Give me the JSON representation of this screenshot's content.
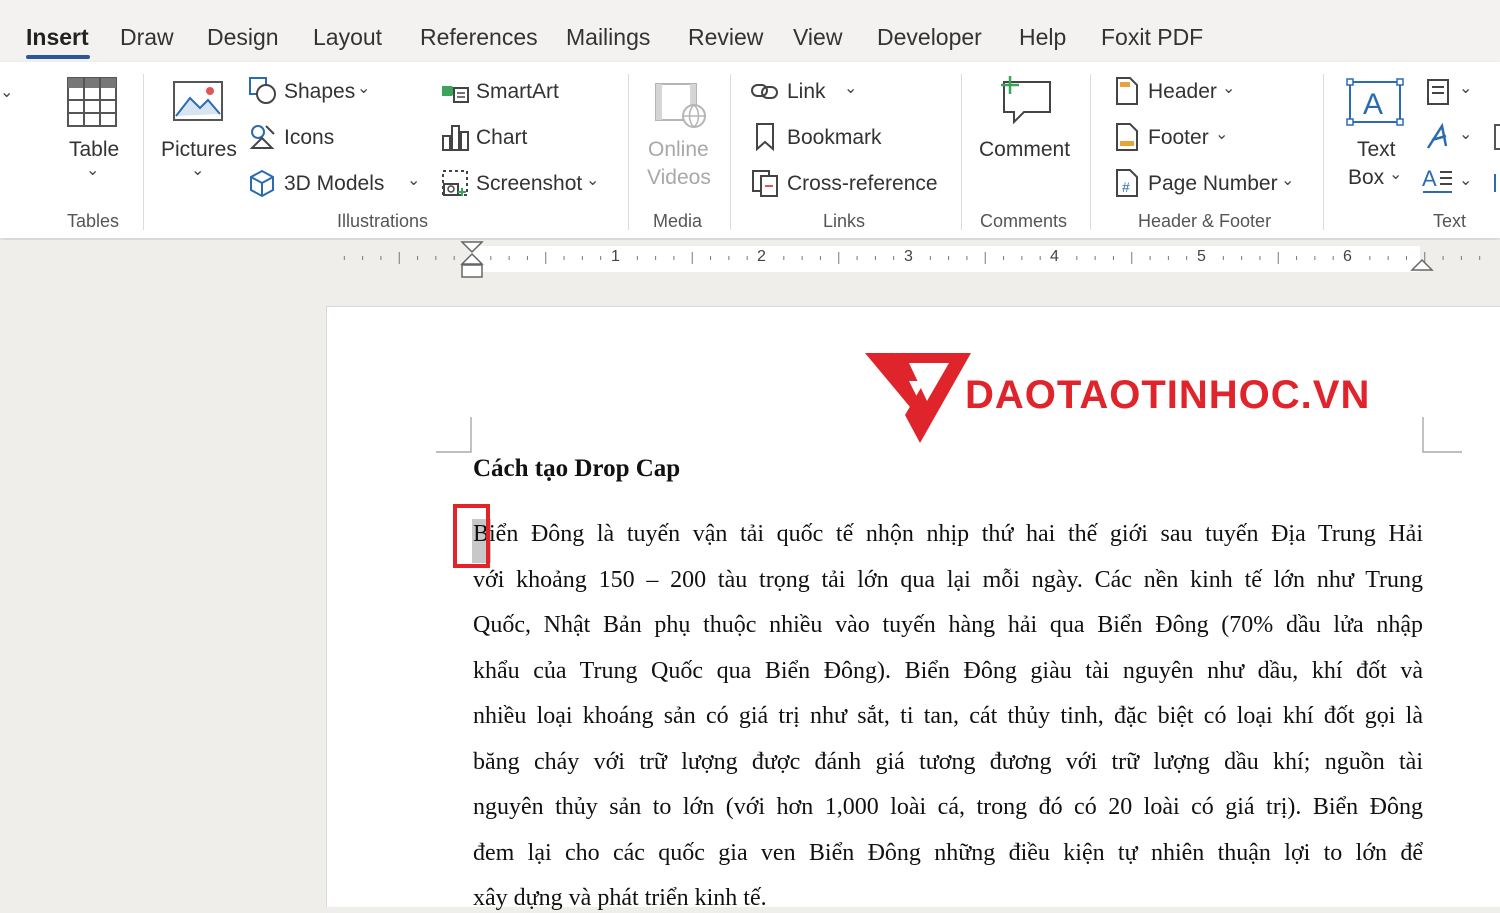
{
  "tabs": [
    "Insert",
    "Draw",
    "Design",
    "Layout",
    "References",
    "Mailings",
    "Review",
    "View",
    "Developer",
    "Help",
    "Foxit PDF"
  ],
  "active_tab": "Insert",
  "ribbon": {
    "tables": {
      "table_label": "Table",
      "group_label": "Tables",
      "icon": "table-icon"
    },
    "illustrations": {
      "pictures_label": "Pictures",
      "shapes_label": "Shapes",
      "icons_label": "Icons",
      "models_label": "3D Models",
      "smartart_label": "SmartArt",
      "chart_label": "Chart",
      "screenshot_label": "Screenshot",
      "group_label": "Illustrations"
    },
    "media": {
      "online_label": "Online",
      "videos_label": "Videos",
      "group_label": "Media"
    },
    "links": {
      "link_label": "Link",
      "bookmark_label": "Bookmark",
      "crossref_label": "Cross-reference",
      "group_label": "Links"
    },
    "comments": {
      "comment_label": "Comment",
      "group_label": "Comments"
    },
    "header_footer": {
      "header_label": "Header",
      "footer_label": "Footer",
      "page_number_label": "Page Number",
      "group_label": "Header & Footer"
    },
    "text": {
      "textbox_label_1": "Text",
      "textbox_label_2": "Box",
      "group_label": "Text"
    }
  },
  "ruler": {
    "numbers": [
      "1",
      "2",
      "3",
      "4",
      "5",
      "6"
    ]
  },
  "document": {
    "logo_text": "DAOTAOTINHOC.VN",
    "heading": "Cách tạo Drop Cap",
    "paragraph_lines": [
      "Biển Đông là tuyến vận tải quốc tế nhộn nhịp thứ hai thế giới sau tuyến Địa Trung Hải",
      "với khoảng 150 – 200 tàu trọng tải lớn qua lại mỗi ngày. Các nền kinh tế lớn như Trung",
      "Quốc, Nhật Bản phụ thuộc nhiều vào tuyến hàng hải qua Biển Đông (70% dầu lửa nhập",
      "khẩu của Trung Quốc qua Biển Đông). Biển Đông giàu tài nguyên như dầu, khí đốt và",
      "nhiều loại khoáng sản có giá trị như sắt, ti tan, cát thủy tinh, đặc biệt có loại khí đốt gọi là",
      "băng cháy với trữ lượng được đánh giá tương đương với trữ lượng dầu khí; nguồn tài",
      "nguyên thủy sản to lớn (với hơn 1,000 loài cá, trong đó có 20 loài có giá trị). Biển Đông",
      "đem lại cho các quốc gia ven Biển Đông những điều kiện tự nhiên  thuận lợi to lớn để",
      "xây dựng và phát triển kinh tế."
    ]
  },
  "colors": {
    "accent": "#2b579a",
    "highlight_box": "#e3232a",
    "logo_red": "#e0242b"
  }
}
